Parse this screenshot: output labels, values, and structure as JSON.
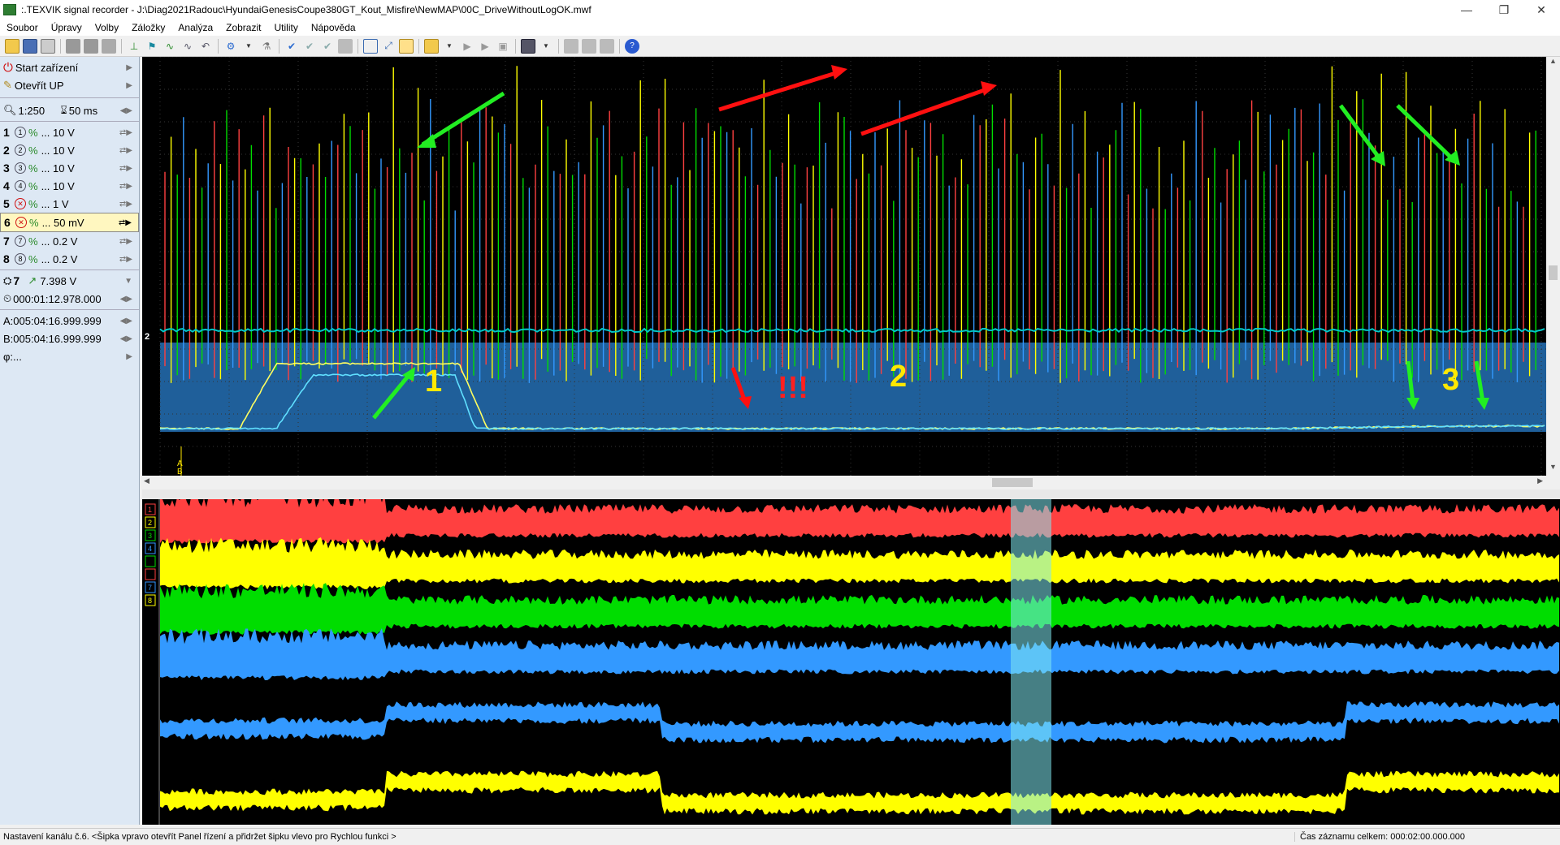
{
  "window": {
    "title": ":.TEXVIK  signal recorder - J:\\Diag2021Radouc\\HyundaiGenesisCoupe380GT_Kout_Misfire\\NewMAP\\00C_DriveWithoutLogOK.mwf",
    "minimize": "—",
    "maximize": "❐",
    "close": "✕"
  },
  "menu": [
    "Soubor",
    "Úpravy",
    "Volby",
    "Záložky",
    "Analýza",
    "Zobrazit",
    "Utility",
    "Nápověda"
  ],
  "sidebar": {
    "start": "Start zařízení",
    "open": "Otevřít UP",
    "zoom": "1:250",
    "timebase": "50 ms",
    "channels": [
      {
        "num": "1",
        "label": "... 10 V"
      },
      {
        "num": "2",
        "label": "... 10 V"
      },
      {
        "num": "3",
        "label": "... 10 V"
      },
      {
        "num": "4",
        "label": "... 10 V"
      },
      {
        "num": "5",
        "label": "... 1 V"
      },
      {
        "num": "6",
        "label": "... 50 mV"
      },
      {
        "num": "7",
        "label": "... 0.2 V"
      },
      {
        "num": "8",
        "label": "... 0.2 V"
      }
    ],
    "trigger_channel": "7",
    "trigger_level": "7.398 V",
    "time": "000:01:12.978.000",
    "cursor_a": "A:005:04:16.999.999",
    "cursor_b": "B:005:04:16.999.999",
    "phi": "φ:..."
  },
  "upper": {
    "labels": [
      "1",
      "2",
      "3"
    ],
    "exclam": "!!!",
    "channel_marker": "2",
    "cursor_a": "A",
    "cursor_b": "B"
  },
  "lower": {
    "channel_badges": [
      "1",
      "2",
      "3",
      "4",
      "",
      "",
      "7",
      "8"
    ]
  },
  "status": {
    "left": "Nastavení kanálu č.6. <Šipka vpravo otevřít Panel řízení a přidržet šipku vlevo pro Rychlou funkci >",
    "right": "Čas záznamu celkem: 000:02:00.000.000"
  },
  "colors": {
    "ch1": "#ff4040",
    "ch2": "#ffff00",
    "ch3": "#00dd00",
    "ch4": "#3399ff",
    "baseline": "#00c8c8",
    "lowerpanel": "#1f5f9a",
    "highlight": "#80e8f0"
  }
}
